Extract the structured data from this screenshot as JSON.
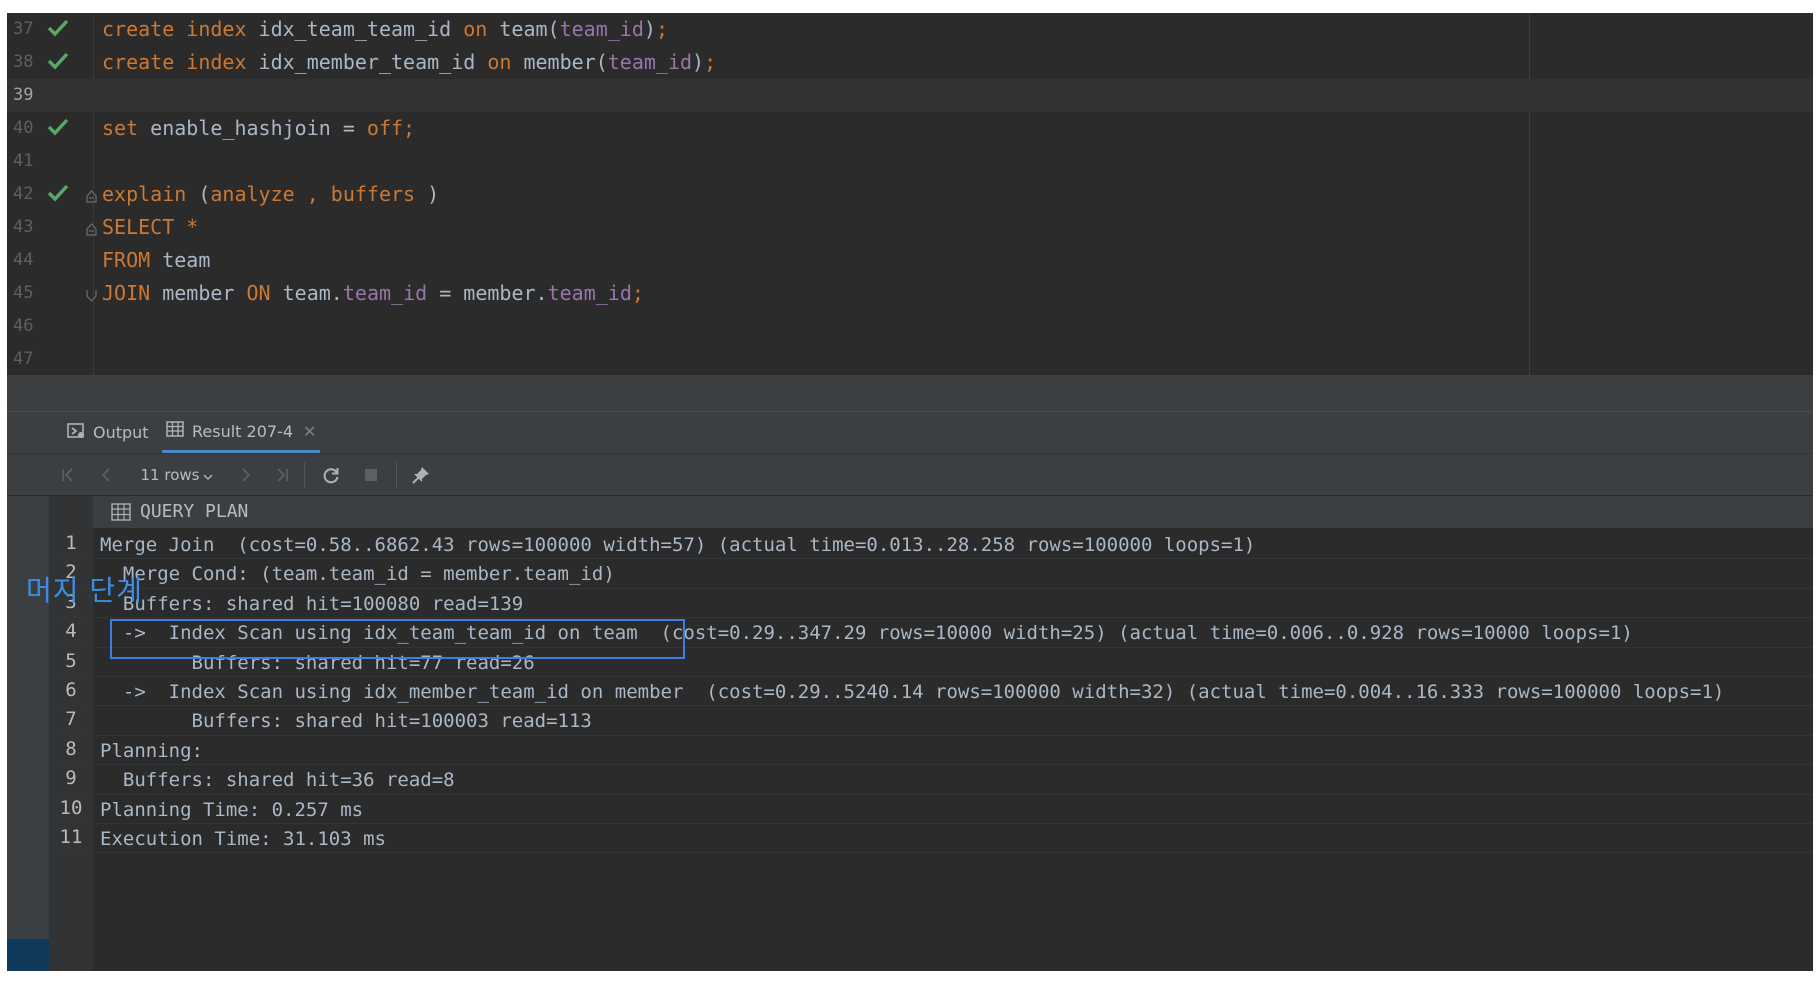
{
  "editor": {
    "lines": [
      {
        "n": "37",
        "status": "check",
        "fold": "",
        "tokens": [
          [
            "kw",
            "create index "
          ],
          [
            "txt",
            "idx_team_team_id "
          ],
          [
            "kw",
            "on "
          ],
          [
            "txt",
            "team("
          ],
          [
            "fld",
            "team_id"
          ],
          [
            "txt",
            ")"
          ],
          [
            "kw",
            ";"
          ]
        ]
      },
      {
        "n": "38",
        "status": "check",
        "fold": "",
        "tokens": [
          [
            "kw",
            "create index "
          ],
          [
            "txt",
            "idx_member_team_id "
          ],
          [
            "kw",
            "on "
          ],
          [
            "txt",
            "member("
          ],
          [
            "fld",
            "team_id"
          ],
          [
            "txt",
            ")"
          ],
          [
            "kw",
            ";"
          ]
        ]
      },
      {
        "n": "39",
        "status": "",
        "fold": "",
        "current": true,
        "tokens": []
      },
      {
        "n": "40",
        "status": "check",
        "fold": "",
        "tokens": [
          [
            "kw",
            "set "
          ],
          [
            "txt",
            "enable_hashjoin = "
          ],
          [
            "kw",
            "off;"
          ]
        ]
      },
      {
        "n": "41",
        "status": "",
        "fold": "",
        "tokens": []
      },
      {
        "n": "42",
        "status": "check",
        "fold": "start",
        "tokens": [
          [
            "kw",
            "explain "
          ],
          [
            "txt",
            "("
          ],
          [
            "kw",
            "analyze , buffers "
          ],
          [
            "txt",
            ")"
          ]
        ]
      },
      {
        "n": "43",
        "status": "",
        "fold": "start",
        "tokens": [
          [
            "kw",
            "SELECT "
          ],
          [
            "kw",
            "*"
          ]
        ]
      },
      {
        "n": "44",
        "status": "",
        "fold": "",
        "tokens": [
          [
            "kw",
            "FROM "
          ],
          [
            "txt",
            "team"
          ]
        ]
      },
      {
        "n": "45",
        "status": "",
        "fold": "end",
        "tokens": [
          [
            "kw",
            "JOIN "
          ],
          [
            "txt",
            "member "
          ],
          [
            "kw",
            "ON "
          ],
          [
            "txt",
            "team."
          ],
          [
            "fld",
            "team_id"
          ],
          [
            "txt",
            " = member."
          ],
          [
            "fld",
            "team_id"
          ],
          [
            "kw",
            ";"
          ]
        ]
      },
      {
        "n": "46",
        "status": "",
        "fold": "",
        "tokens": []
      },
      {
        "n": "47",
        "status": "",
        "fold": "",
        "tokens": []
      }
    ]
  },
  "tabs": [
    {
      "label": "Output",
      "icon": "output-icon",
      "active": false
    },
    {
      "label": "Result 207-4",
      "icon": "table-icon",
      "active": true,
      "closable": true
    }
  ],
  "toolbar": {
    "rows_label": "11 rows",
    "edge_text": "C"
  },
  "grid": {
    "column_header": "QUERY PLAN",
    "rows": [
      {
        "n": "1",
        "text": "Merge Join  (cost=0.58..6862.43 rows=100000 width=57) (actual time=0.013..28.258 rows=100000 loops=1)"
      },
      {
        "n": "2",
        "text": "  Merge Cond: (team.team_id = member.team_id)"
      },
      {
        "n": "3",
        "text": "  Buffers: shared hit=100080 read=139"
      },
      {
        "n": "4",
        "text": "  ->  Index Scan using idx_team_team_id on team  (cost=0.29..347.29 rows=10000 width=25) (actual time=0.006..0.928 rows=10000 loops=1)"
      },
      {
        "n": "5",
        "text": "        Buffers: shared hit=77 read=26"
      },
      {
        "n": "6",
        "text": "  ->  Index Scan using idx_member_team_id on member  (cost=0.29..5240.14 rows=100000 width=32) (actual time=0.004..16.333 rows=100000 loops=1)"
      },
      {
        "n": "7",
        "text": "        Buffers: shared hit=100003 read=113"
      },
      {
        "n": "8",
        "text": "Planning:"
      },
      {
        "n": "9",
        "text": "  Buffers: shared hit=36 read=8"
      },
      {
        "n": "10",
        "text": "Planning Time: 0.257 ms"
      },
      {
        "n": "11",
        "text": "Execution Time: 31.103 ms"
      }
    ]
  },
  "annotation": {
    "text": "머지 단계",
    "color": "#3a8ee6"
  }
}
